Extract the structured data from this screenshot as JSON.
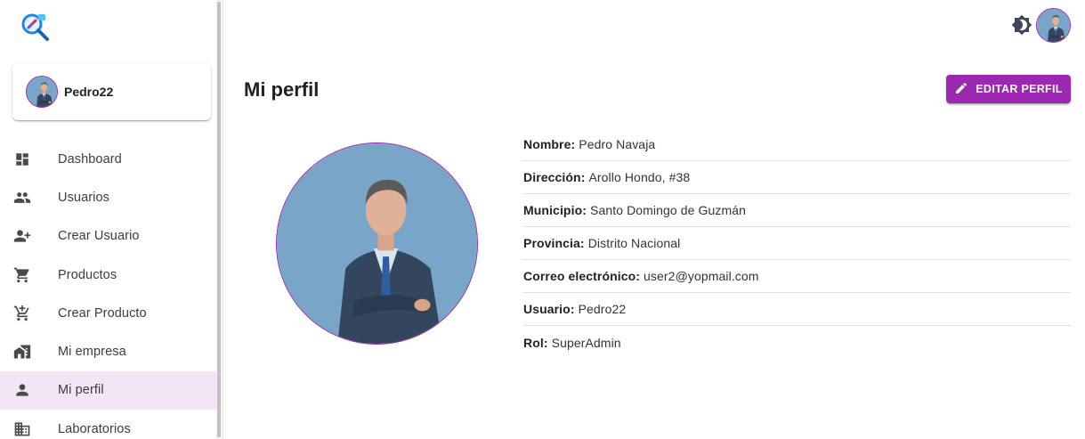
{
  "colors": {
    "accent": "#9c27b0",
    "active_bg": "#f3e5f5",
    "icon": "#4a4a4a"
  },
  "sidebar": {
    "user": {
      "name": "Pedro22"
    },
    "items": [
      {
        "label": "Dashboard",
        "icon": "dashboard-icon"
      },
      {
        "label": "Usuarios",
        "icon": "people-icon"
      },
      {
        "label": "Crear Usuario",
        "icon": "person-add-icon"
      },
      {
        "label": "Productos",
        "icon": "cart-icon"
      },
      {
        "label": "Crear Producto",
        "icon": "add-to-cart-icon"
      },
      {
        "label": "Mi empresa",
        "icon": "home-work-icon"
      },
      {
        "label": "Mi perfil",
        "icon": "person-icon",
        "active": true
      },
      {
        "label": "Laboratorios",
        "icon": "business-icon"
      }
    ]
  },
  "header": {
    "theme_icon": "brightness-icon"
  },
  "main": {
    "title": "Mi perfil",
    "edit_button": "EDITAR PERFIL",
    "details": [
      {
        "label": "Nombre:",
        "value": "Pedro Navaja"
      },
      {
        "label": "Dirección:",
        "value": "Arollo Hondo, #38"
      },
      {
        "label": "Municipio:",
        "value": "Santo Domingo de Guzmán"
      },
      {
        "label": "Provincia:",
        "value": "Distrito Nacional"
      },
      {
        "label": "Correo electrónico:",
        "value": "user2@yopmail.com"
      },
      {
        "label": "Usuario:",
        "value": "Pedro22"
      },
      {
        "label": "Rol:",
        "value": "SuperAdmin"
      }
    ]
  }
}
